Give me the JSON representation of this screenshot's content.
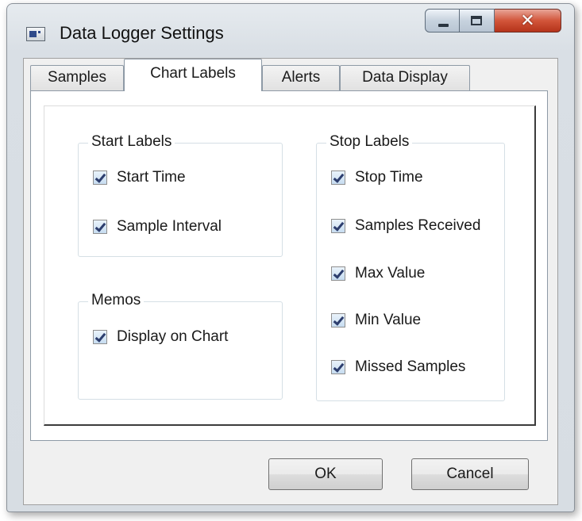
{
  "window": {
    "title": "Data Logger Settings"
  },
  "tabs": [
    {
      "label": "Samples",
      "active": false
    },
    {
      "label": "Chart Labels",
      "active": true
    },
    {
      "label": "Alerts",
      "active": false
    },
    {
      "label": "Data Display",
      "active": false
    }
  ],
  "groups": {
    "start_labels": {
      "legend": "Start Labels",
      "items": [
        {
          "label": "Start Time",
          "checked": true
        },
        {
          "label": "Sample Interval",
          "checked": true
        }
      ]
    },
    "memos": {
      "legend": "Memos",
      "items": [
        {
          "label": "Display on Chart",
          "checked": true
        }
      ]
    },
    "stop_labels": {
      "legend": "Stop Labels",
      "items": [
        {
          "label": "Stop Time",
          "checked": true
        },
        {
          "label": "Samples Received",
          "checked": true
        },
        {
          "label": "Max Value",
          "checked": true
        },
        {
          "label": "Min Value",
          "checked": true
        },
        {
          "label": "Missed Samples",
          "checked": true
        }
      ]
    }
  },
  "buttons": {
    "ok": "OK",
    "cancel": "Cancel"
  },
  "icons": {
    "app": "app-window-icon",
    "minimize": "minimize-icon",
    "maximize": "maximize-icon",
    "close": "close-icon"
  },
  "colors": {
    "close_button": "#d2553a",
    "check_mark": "#2d3e6e"
  }
}
